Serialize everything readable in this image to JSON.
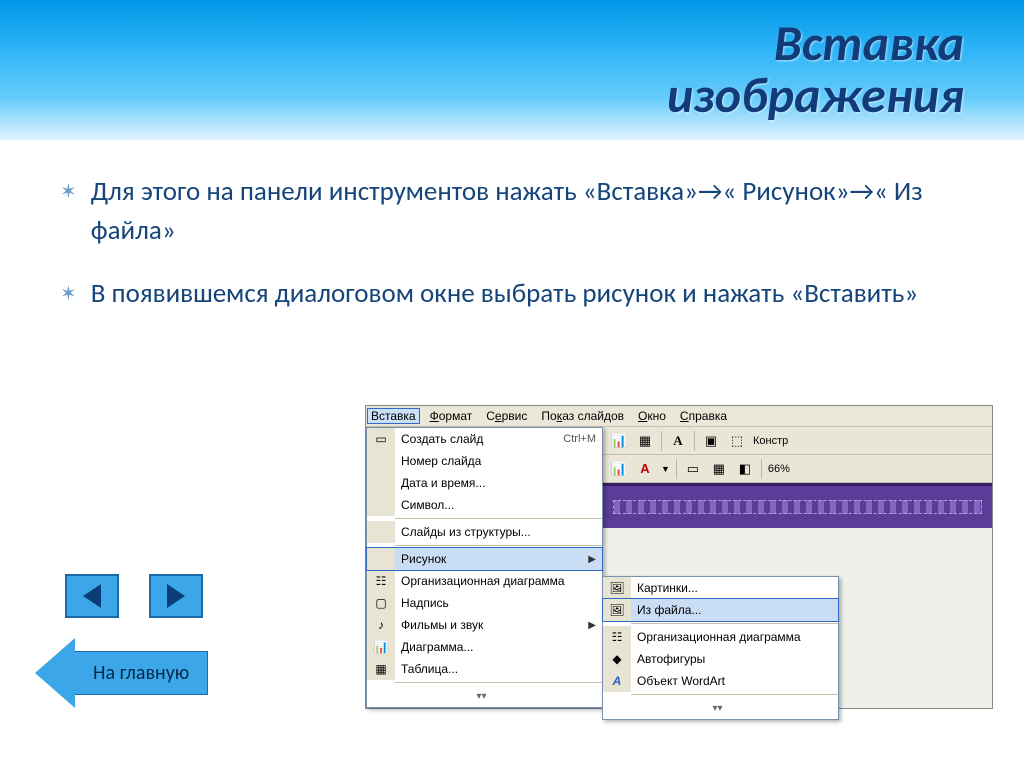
{
  "slide": {
    "title_line1": "Вставка",
    "title_line2": "изображения",
    "bullet1": "Для этого на панели инструментов нажать «Вставка»→« Рисунок»→« Из файла»",
    "bullet2": "В появившемся диалоговом окне выбрать рисунок и нажать «Вставить»",
    "home_label": "На главную"
  },
  "menubar": {
    "items": [
      "Вставка",
      "Формат",
      "Сервис",
      "Показ слайдов",
      "Окно",
      "Справка"
    ]
  },
  "dropdown": {
    "items": [
      {
        "label": "Создать слайд",
        "shortcut": "Ctrl+M",
        "icon": "📄"
      },
      {
        "label": "Номер слайда",
        "icon": ""
      },
      {
        "label": "Дата и время...",
        "icon": ""
      },
      {
        "label": "Символ...",
        "icon": ""
      },
      {
        "label": "Слайды из структуры...",
        "icon": ""
      },
      {
        "label": "Рисунок",
        "icon": "",
        "arrow": true,
        "highlight": true
      },
      {
        "label": "Организационная диаграмма",
        "icon": "🔷"
      },
      {
        "label": "Надпись",
        "icon": "📝"
      },
      {
        "label": "Фильмы и звук",
        "icon": "🎵",
        "arrow": true
      },
      {
        "label": "Диаграмма...",
        "icon": "📊"
      },
      {
        "label": "Таблица...",
        "icon": "▦"
      }
    ]
  },
  "submenu": {
    "items": [
      {
        "label": "Картинки...",
        "icon": "🖼"
      },
      {
        "label": "Из файла...",
        "icon": "🖼",
        "highlight": true
      },
      {
        "label": "Организационная диаграмма",
        "icon": "📊"
      },
      {
        "label": "Автофигуры",
        "icon": "🔶"
      },
      {
        "label": "Объект WordArt",
        "icon": "🅰"
      }
    ]
  },
  "toolbar": {
    "konstr": "Констр",
    "zoom": "66%"
  }
}
